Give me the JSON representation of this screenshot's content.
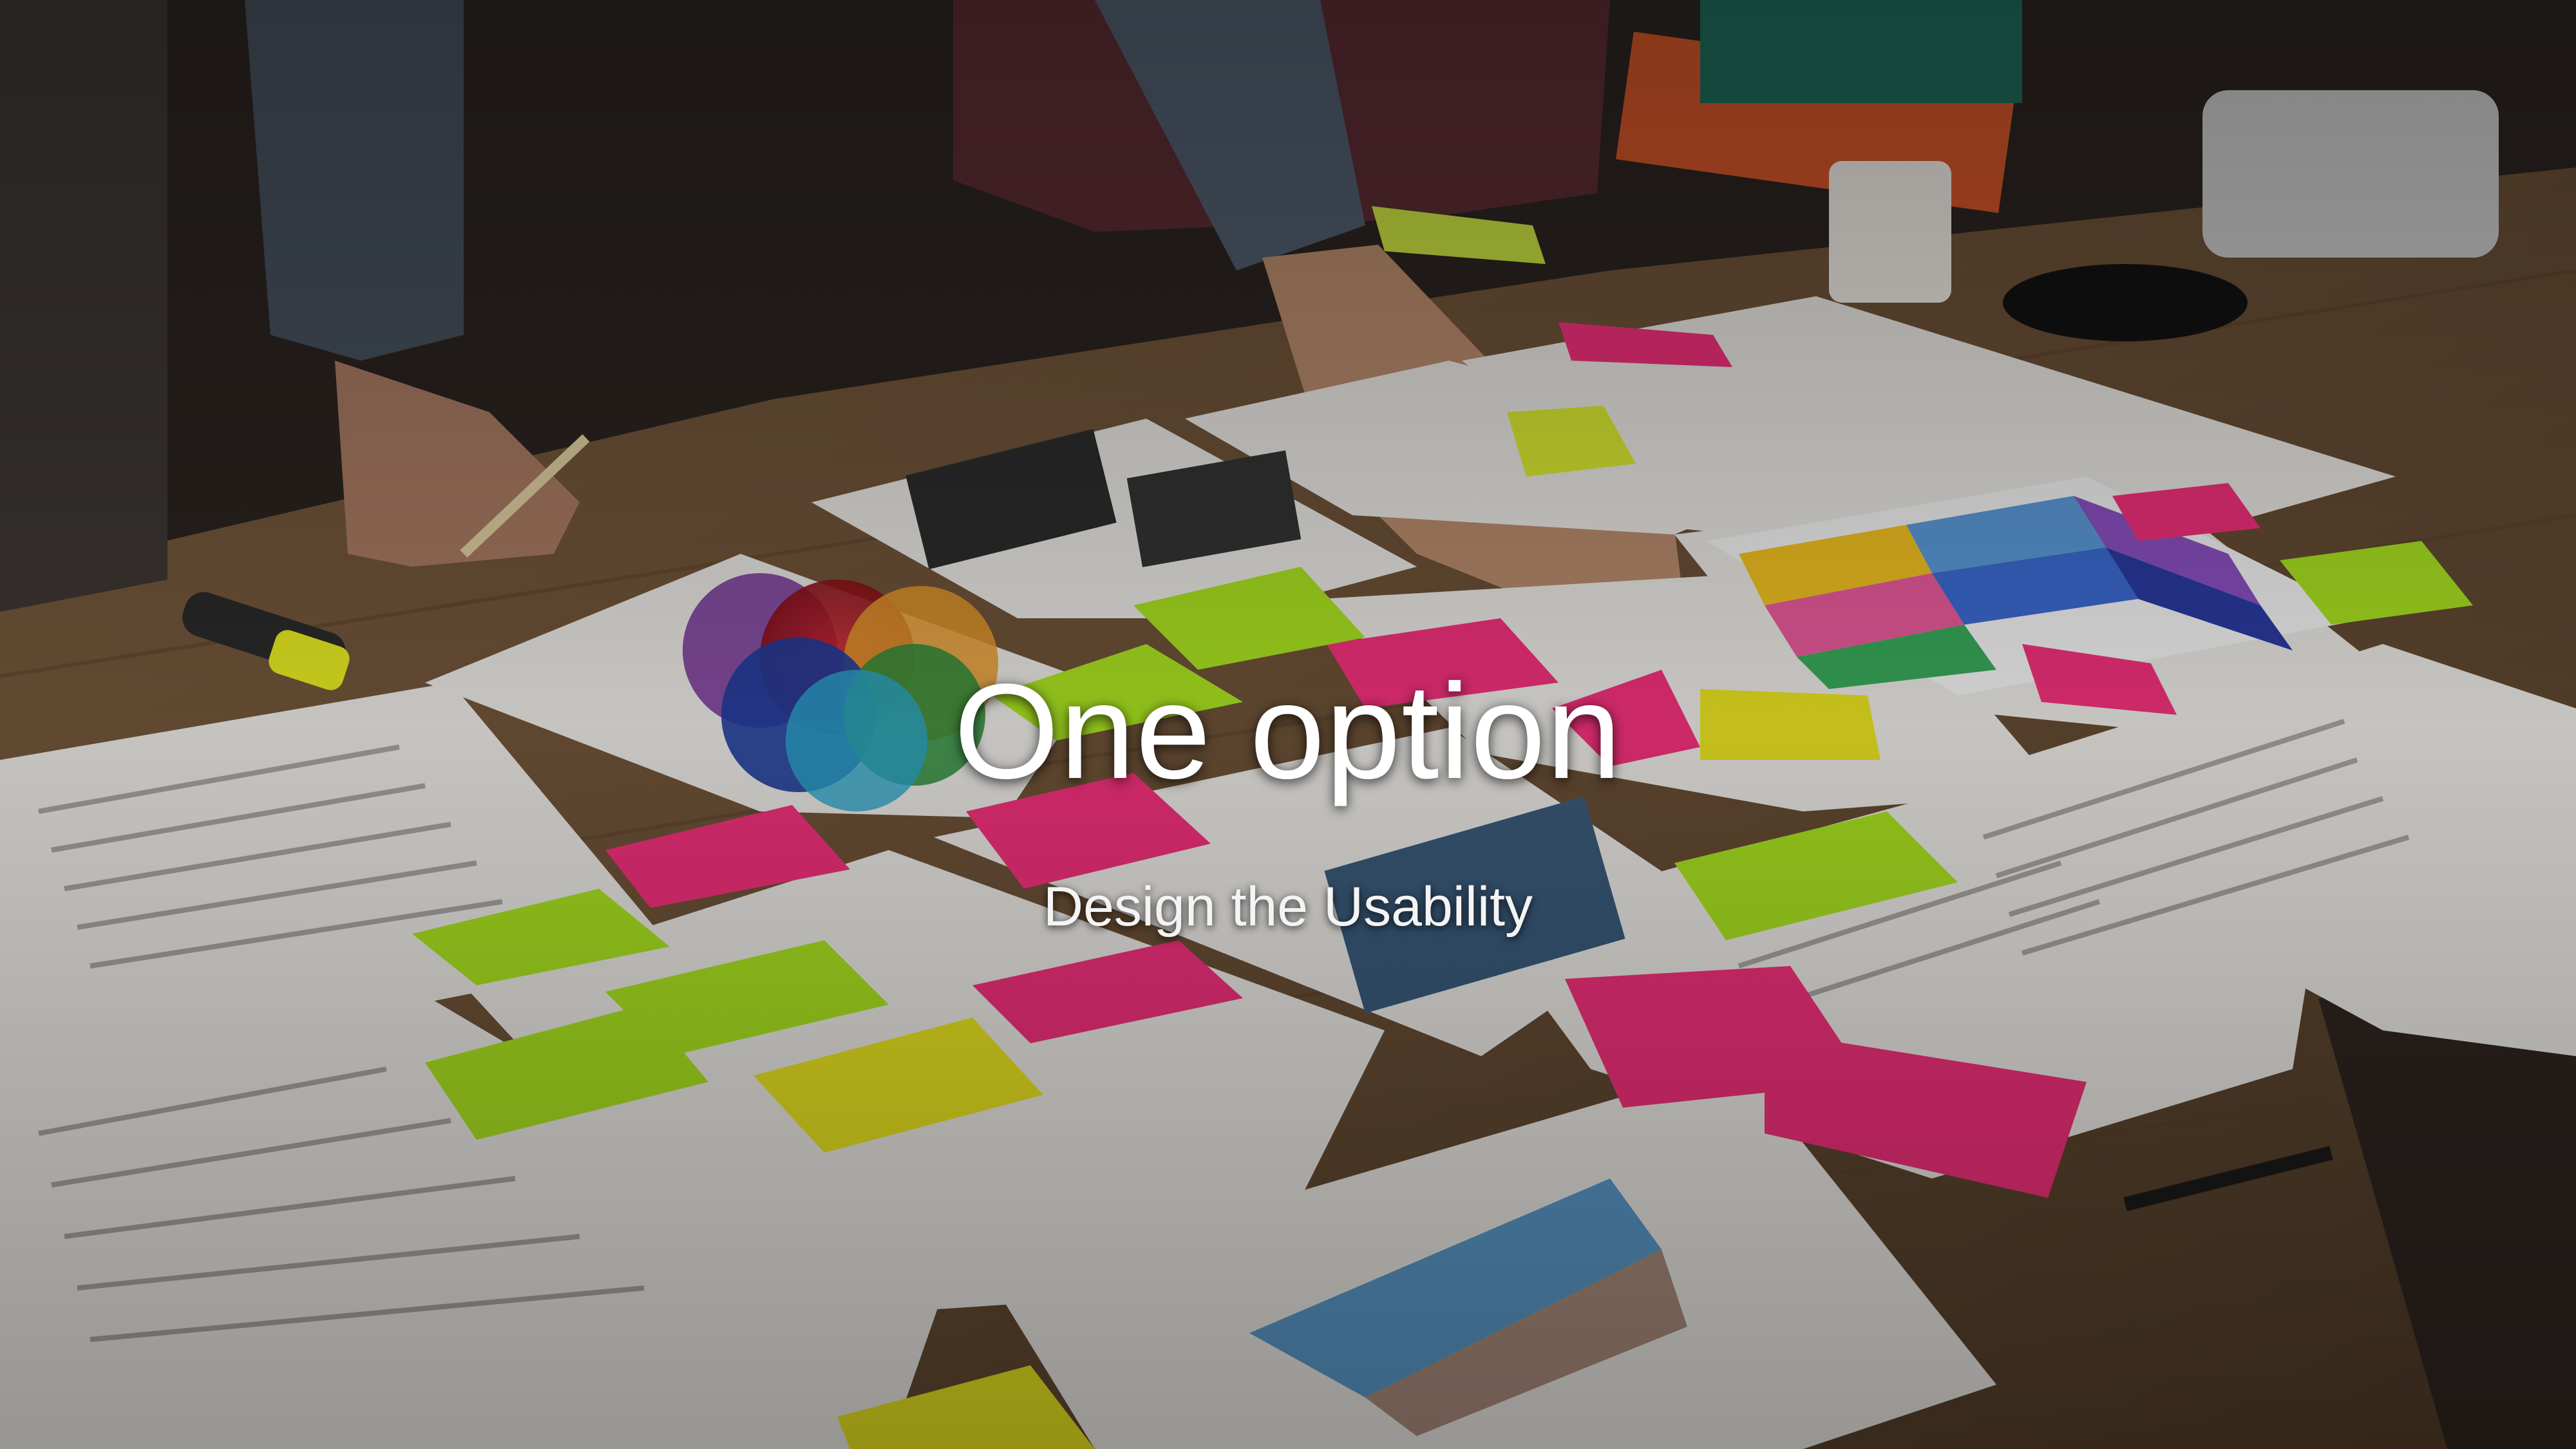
{
  "slide": {
    "title": "One option",
    "subtitle": "Design the Usability",
    "background_photo": "team-planning-on-table-photo"
  },
  "colors": {
    "table_wood": "#6b5036",
    "paper": "#e8e6e2",
    "sticky_pink": "#f0307a",
    "sticky_green": "#a8e020",
    "sticky_yellow": "#e6e020",
    "title_text": "#ffffff"
  }
}
